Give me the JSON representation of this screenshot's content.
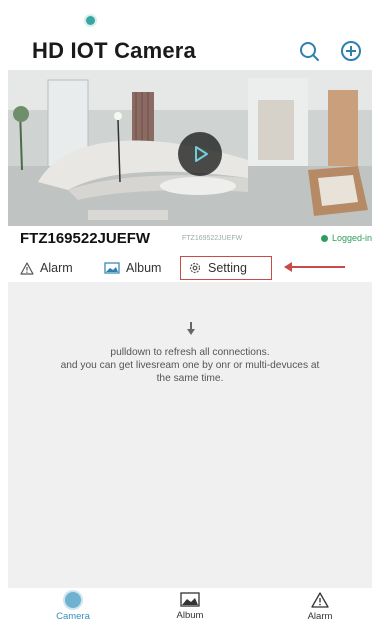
{
  "app": {
    "title": "HD IOT Camera"
  },
  "camera": {
    "name": "FTZ169522JUEFW",
    "uid": "FTZ169522JUEFW",
    "status": "Logged-in",
    "status_color": "#2e9e5b"
  },
  "actions": {
    "alarm": "Alarm",
    "album": "Album",
    "setting": "Setting"
  },
  "hint": {
    "line1": "pulldown to refresh all connections.",
    "line2": "and you can get livesream one by onr or multi-devuces at",
    "line3": "the same time."
  },
  "tabs": [
    {
      "label": "Camera",
      "icon": "camera-icon",
      "active": true
    },
    {
      "label": "Album",
      "icon": "album-icon",
      "active": false
    },
    {
      "label": "Alarm",
      "icon": "alarm-icon",
      "active": false
    }
  ],
  "colors": {
    "accent": "#3a8fbf",
    "highlight": "#c84a4a"
  }
}
